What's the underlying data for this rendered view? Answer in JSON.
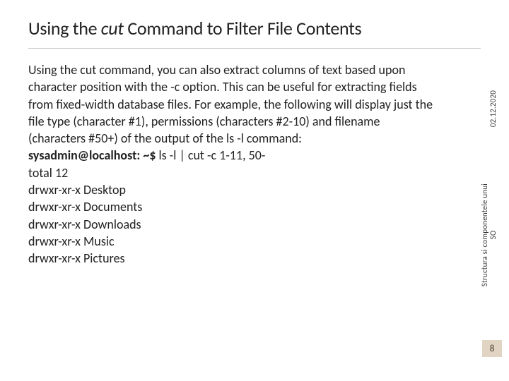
{
  "slide": {
    "title_pre": "Using the ",
    "title_cmd": "cut",
    "title_post": " Command to Filter File Contents",
    "paragraph": "Using the cut command, you can also extract columns of text based upon character position with the -c option. This can be useful for extracting fields from fixed-width database files. For example, the following will display just the file type (character #1), permissions (characters #2-10) and filename (characters #50+) of the output of the ls -l command:",
    "prompt": "sysadmin@localhost: ~$ ",
    "command": "ls -l | cut -c 1-11, 50-",
    "output": [
      "total 12",
      "drwxr-xr-x Desktop",
      "drwxr-xr-x Documents",
      "drwxr-xr-x Downloads",
      "drwxr-xr-x Music",
      "drwxr-xr-x Pictures"
    ],
    "side_date": "02.12.2020",
    "side_source_l1": "Structura si componentele unui",
    "side_source_l2": "SO",
    "page_number": "8"
  }
}
